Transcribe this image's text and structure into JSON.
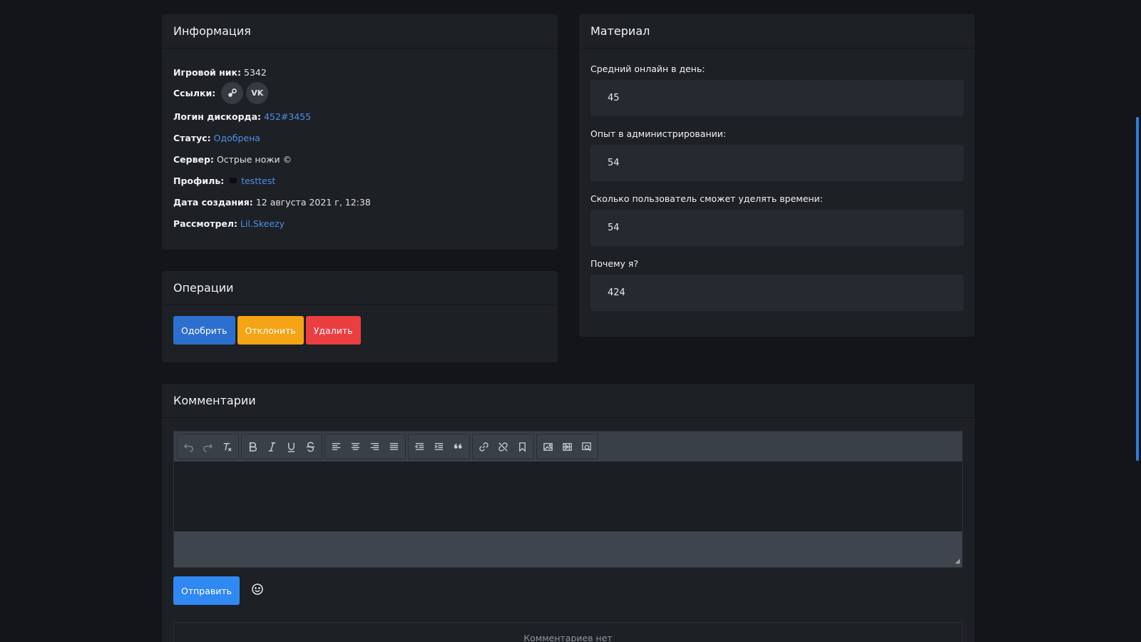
{
  "info": {
    "title": "Информация",
    "nick_label": "Игровой ник:",
    "nick_value": "5342",
    "links_label": "Ссылки:",
    "links": [
      {
        "icon": "steam-icon"
      },
      {
        "icon": "vk-icon",
        "text": "VK"
      }
    ],
    "discord_label": "Логин дискорда:",
    "discord_value": "452#3455",
    "status_label": "Статус:",
    "status_value": "Одобрена",
    "server_label": "Сервер:",
    "server_value": "Острые ножи ©",
    "profile_label": "Профиль:",
    "profile_value": "testtest",
    "created_label": "Дата создания:",
    "created_value": "12 августа 2021 г, 12:38",
    "reviewer_label": "Рассмотрел:",
    "reviewer_value": "Lil.Skeezy"
  },
  "operations": {
    "title": "Операции",
    "approve": "Одобрить",
    "reject": "Отклонить",
    "delete": "Удалить"
  },
  "material": {
    "title": "Материал",
    "fields": [
      {
        "label": "Средний онлайн в день:",
        "value": "45"
      },
      {
        "label": "Опыт в администрировании:",
        "value": "54"
      },
      {
        "label": "Сколько пользователь сможет уделять времени:",
        "value": "54"
      },
      {
        "label": "Почему я?",
        "value": "424"
      }
    ]
  },
  "comments": {
    "title": "Комментарии",
    "send": "Отправить",
    "empty": "Комментариев нет"
  },
  "colors": {
    "accent": "#3088f2",
    "link": "#4e8fe8",
    "warning": "#f5a415",
    "danger": "#ea3e41"
  }
}
